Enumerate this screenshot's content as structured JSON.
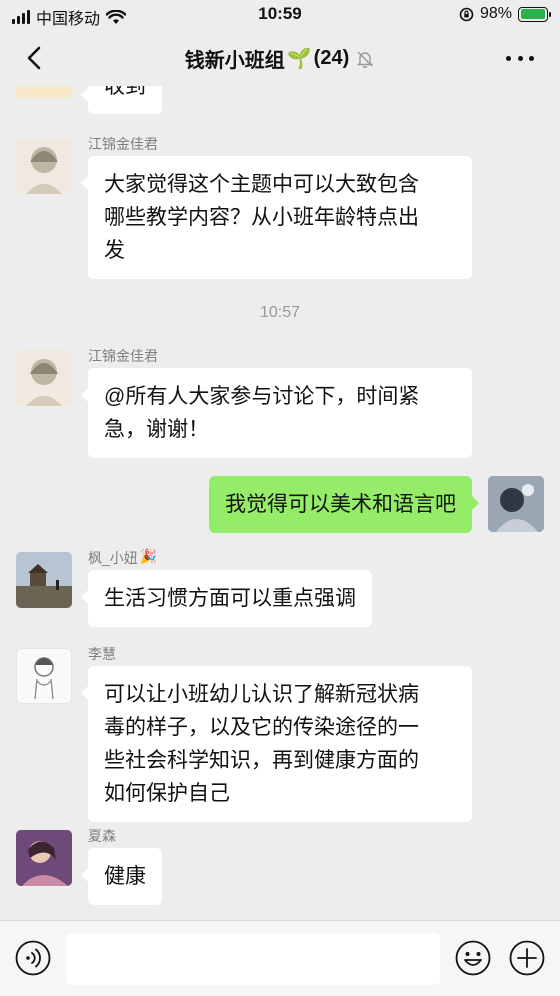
{
  "status_bar": {
    "carrier": "中国移动",
    "time": "10:59",
    "battery_percent": "98%",
    "battery_level": 0.98,
    "wifi_icon": "wifi-icon",
    "lock_icon": "orientation-lock-icon"
  },
  "nav": {
    "title": "钱新小班组",
    "title_emoji": "🌱",
    "member_count": "(24)",
    "mute_icon": "bell-mute-icon"
  },
  "chat": {
    "partial_message": "收到",
    "timestamp": "10:57",
    "messages": [
      {
        "sender": "江锦金佳君",
        "lines": [
          "大家觉得这个主题中可以大致包含",
          "哪些教学内容？从小班年龄特点出",
          "发"
        ]
      },
      {
        "sender": "江锦金佳君",
        "lines": [
          "@所有人大家参与讨论下，时间紧",
          "急，谢谢！"
        ]
      },
      {
        "sender": "",
        "mine": true,
        "lines": [
          "我觉得可以美术和语言吧"
        ]
      },
      {
        "sender": "枫_小妞",
        "sender_emoji": "🎉",
        "lines": [
          "生活习惯方面可以重点强调"
        ]
      },
      {
        "sender": "李慧",
        "lines": [
          "可以让小班幼儿认识了解新冠状病",
          "毒的样子，以及它的传染途径的一",
          "些社会科学知识，再到健康方面的",
          "如何保护自己"
        ]
      },
      {
        "sender": "夏森",
        "lines": [
          "健康"
        ]
      }
    ]
  },
  "colors": {
    "background": "#ededed",
    "my_bubble": "#95ec69",
    "other_bubble": "#ffffff",
    "battery_green": "#2bb24c"
  },
  "input_bar": {
    "voice_icon": "voice-icon",
    "emoji_icon": "emoji-icon",
    "plus_icon": "plus-icon"
  }
}
